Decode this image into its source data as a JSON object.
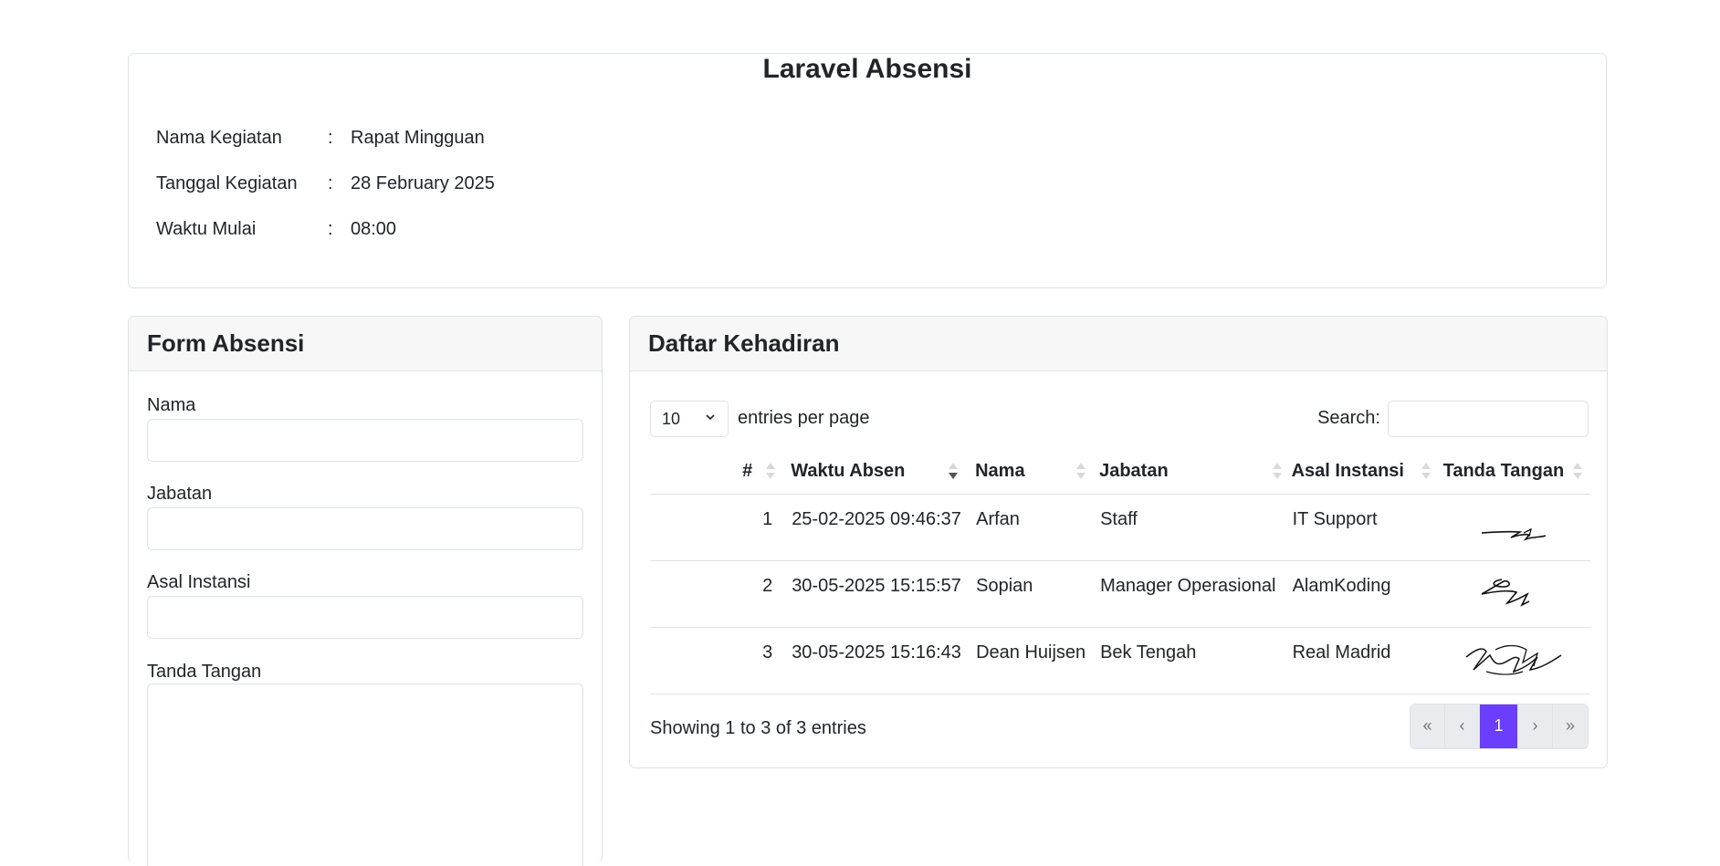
{
  "info": {
    "title": "Laravel Absensi",
    "rows": [
      {
        "label": "Nama Kegiatan",
        "value": "Rapat Mingguan"
      },
      {
        "label": "Tanggal Kegiatan",
        "value": "28 February 2025"
      },
      {
        "label": "Waktu Mulai",
        "value": "08:00"
      }
    ],
    "separator": ":"
  },
  "form": {
    "title": "Form Absensi",
    "fields": {
      "nama": "Nama",
      "jabatan": "Jabatan",
      "asal_instansi": "Asal Instansi",
      "tanda_tangan": "Tanda Tangan"
    }
  },
  "list": {
    "title": "Daftar Kehadiran",
    "page_size": "10",
    "entries_text": "entries per page",
    "search_label": "Search:",
    "columns": [
      "#",
      "Waktu Absen",
      "Nama",
      "Jabatan",
      "Asal Instansi",
      "Tanda Tangan"
    ],
    "rows": [
      {
        "no": "1",
        "waktu": "25-02-2025 09:46:37",
        "nama": "Arfan",
        "jabatan": "Staff",
        "instansi": "IT Support"
      },
      {
        "no": "2",
        "waktu": "30-05-2025 15:15:57",
        "nama": "Sopian",
        "jabatan": "Manager Operasional",
        "instansi": "AlamKoding"
      },
      {
        "no": "3",
        "waktu": "30-05-2025 15:16:43",
        "nama": "Dean Huijsen",
        "jabatan": "Bek Tengah",
        "instansi": "Real Madrid"
      }
    ],
    "showing": "Showing 1 to 3 of 3 entries",
    "pagination": {
      "first": "«",
      "prev": "‹",
      "current": "1",
      "next": "›",
      "last": "»"
    }
  },
  "colors": {
    "accent": "#6a3dff",
    "border": "#dee2e6",
    "header_bg": "#f7f7f7"
  }
}
